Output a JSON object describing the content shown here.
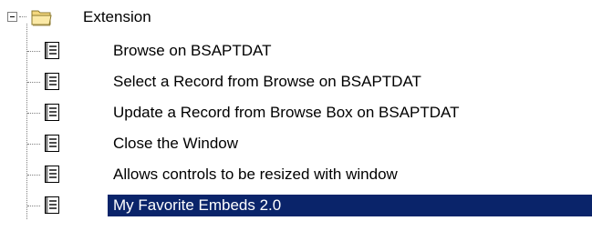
{
  "tree": {
    "root": {
      "label": "Extension",
      "icon": "folder-open-icon",
      "expanded": true
    },
    "items": [
      {
        "label": "Browse on BSAPTDAT",
        "icon": "document-icon",
        "selected": false
      },
      {
        "label": "Select a Record from Browse on BSAPTDAT",
        "icon": "document-icon",
        "selected": false
      },
      {
        "label": "Update a Record from Browse Box on BSAPTDAT",
        "icon": "document-icon",
        "selected": false
      },
      {
        "label": "Close the Window",
        "icon": "document-icon",
        "selected": false
      },
      {
        "label": "Allows controls to be resized with window",
        "icon": "document-icon",
        "selected": false
      },
      {
        "label": "My Favorite Embeds 2.0",
        "icon": "document-icon",
        "selected": true
      }
    ]
  },
  "colors": {
    "selection_background": "#0a246a",
    "selection_text": "#ffffff",
    "folder": "#f4d77e",
    "connector": "#808080"
  }
}
